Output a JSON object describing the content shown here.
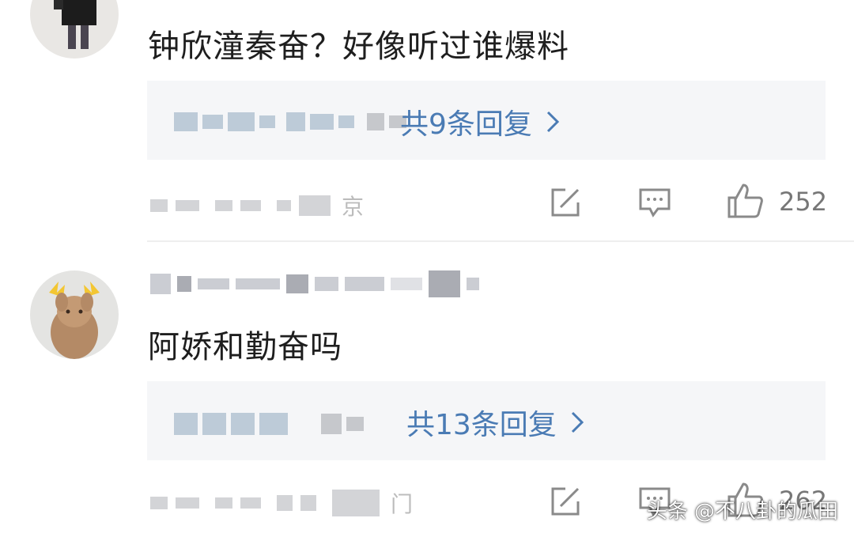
{
  "comments": [
    {
      "text": "钟欣潼秦奋？好像听过谁爆料",
      "reply_link": "共9条回复",
      "meta_suffix": "京",
      "likes": "252"
    },
    {
      "text": "阿娇和勤奋吗",
      "reply_link": "共13条回复",
      "meta_suffix": "门",
      "likes": "262"
    }
  ],
  "watermark": "头条 @不八卦的瓜田",
  "icons": {
    "share": "share-icon",
    "comment": "comment-icon",
    "like": "thumbs-up-icon",
    "chevron": "chevron-right-icon"
  },
  "colors": {
    "reply_link": "#4a7bb4",
    "reply_box_bg": "#f5f6f8",
    "icon_gray": "#8a8a8a"
  }
}
